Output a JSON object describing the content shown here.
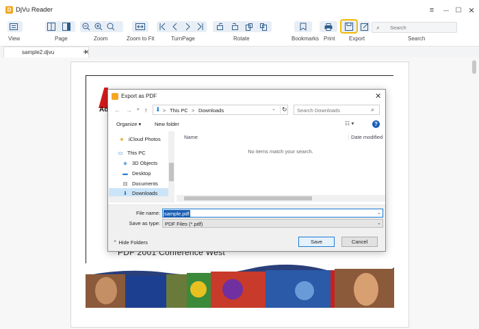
{
  "app": {
    "title": "DjVu Reader"
  },
  "window_controls": {
    "menu": "≡",
    "minimize": "—",
    "maximize": "☐",
    "close": "✕"
  },
  "toolbar": {
    "labels": {
      "view": "View",
      "page": "Page",
      "zoom": "Zoom",
      "zoom_to_fit": "Zoom to Fit",
      "turnpage": "TurnPage",
      "rotate": "Rotate",
      "bookmarks": "Bookmarks",
      "print": "Print",
      "export": "Export",
      "search": "Search"
    },
    "search_placeholder": "Search"
  },
  "tabs": [
    {
      "label": "sample2.djvu"
    }
  ],
  "document": {
    "logo_text": "Ad",
    "conference_text": "PDF 2001 Conference West"
  },
  "dialog": {
    "title": "Export as PDF",
    "address": {
      "segments": [
        "This PC",
        "Downloads"
      ],
      "separator": ">"
    },
    "search_placeholder": "Search Downloads",
    "commands": {
      "organize": "Organize ▾",
      "new_folder": "New folder"
    },
    "nav_items": [
      {
        "label": "iCloud Photos",
        "icon": "folder-icon"
      },
      {
        "label": "This PC",
        "icon": "computer-icon"
      },
      {
        "label": "3D Objects",
        "icon": "3d-objects-icon"
      },
      {
        "label": "Desktop",
        "icon": "desktop-icon"
      },
      {
        "label": "Documents",
        "icon": "documents-icon"
      },
      {
        "label": "Downloads",
        "icon": "downloads-icon",
        "selected": true
      }
    ],
    "columns": {
      "name": "Name",
      "date_modified": "Date modified"
    },
    "empty_message": "No items match your search.",
    "file_name_label": "File name:",
    "file_name_value": "sample.pdf",
    "save_as_type_label": "Save as type:",
    "save_as_type_value": "PDF Files (*.pdf)",
    "hide_folders": "Hide Folders",
    "save_button": "Save",
    "cancel_button": "Cancel"
  },
  "colors": {
    "accent": "#1a7ad4",
    "export_highlight": "#f5b800",
    "toolbar_icon": "#2b5a8c"
  }
}
